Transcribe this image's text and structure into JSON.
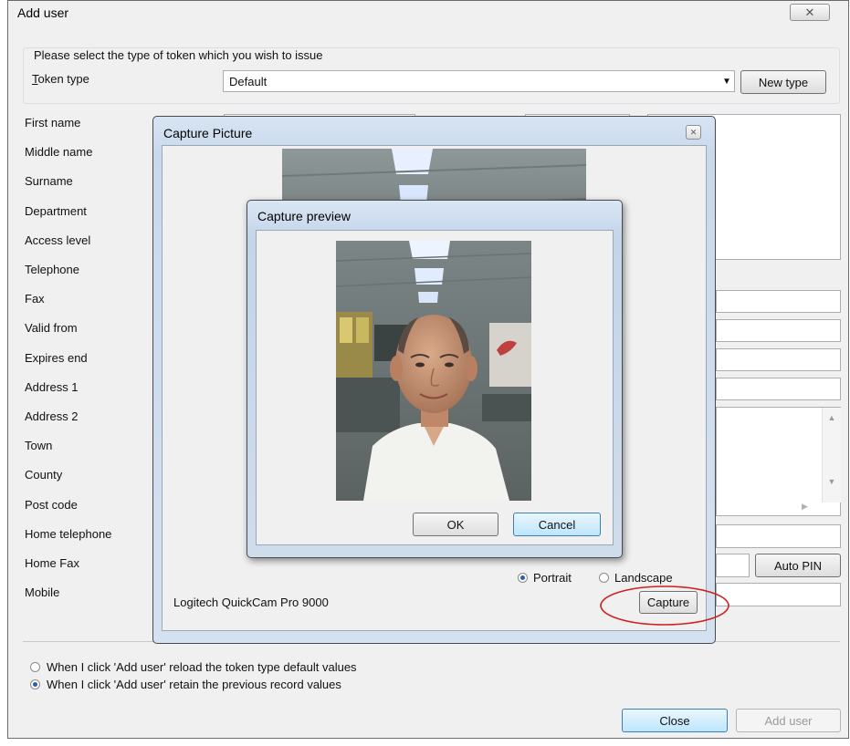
{
  "main_window": {
    "title": "Add user",
    "close_glyph": "✕",
    "token_group_caption": "Please select the type of token which you wish to issue",
    "token_type_label_first": "T",
    "token_type_label_rest": "oken type",
    "token_type_value": "Default",
    "new_type_button": "New type",
    "fields": [
      "First name",
      "Middle name",
      "Surname",
      "Department",
      "Access level",
      "Telephone",
      "Fax",
      "Valid from",
      "Expires end",
      "Address 1",
      "Address 2",
      "Town",
      "County",
      "Post code",
      "Home telephone",
      "Home Fax",
      "Mobile"
    ],
    "auto_pin_button": "Auto PIN",
    "radio_reload": "When I click 'Add user' reload the token type default values",
    "radio_retain": "When I click 'Add user' retain the previous record values",
    "radio_selected": "retain",
    "close_button": "Close",
    "add_user_button": "Add user"
  },
  "capture_picture": {
    "title": "Capture Picture",
    "close_glyph": "✕",
    "orientation_portrait": "Portrait",
    "orientation_landscape": "Landscape",
    "orientation_selected": "portrait",
    "camera_name": "Logitech QuickCam Pro 9000",
    "capture_button": "Capture"
  },
  "capture_preview": {
    "title": "Capture preview",
    "ok_button": "OK",
    "cancel_button": "Cancel"
  },
  "colors": {
    "highlight_circle": "#d02020",
    "radio_dot": "#2c5fa8",
    "focus_border": "#3c7fb1"
  }
}
